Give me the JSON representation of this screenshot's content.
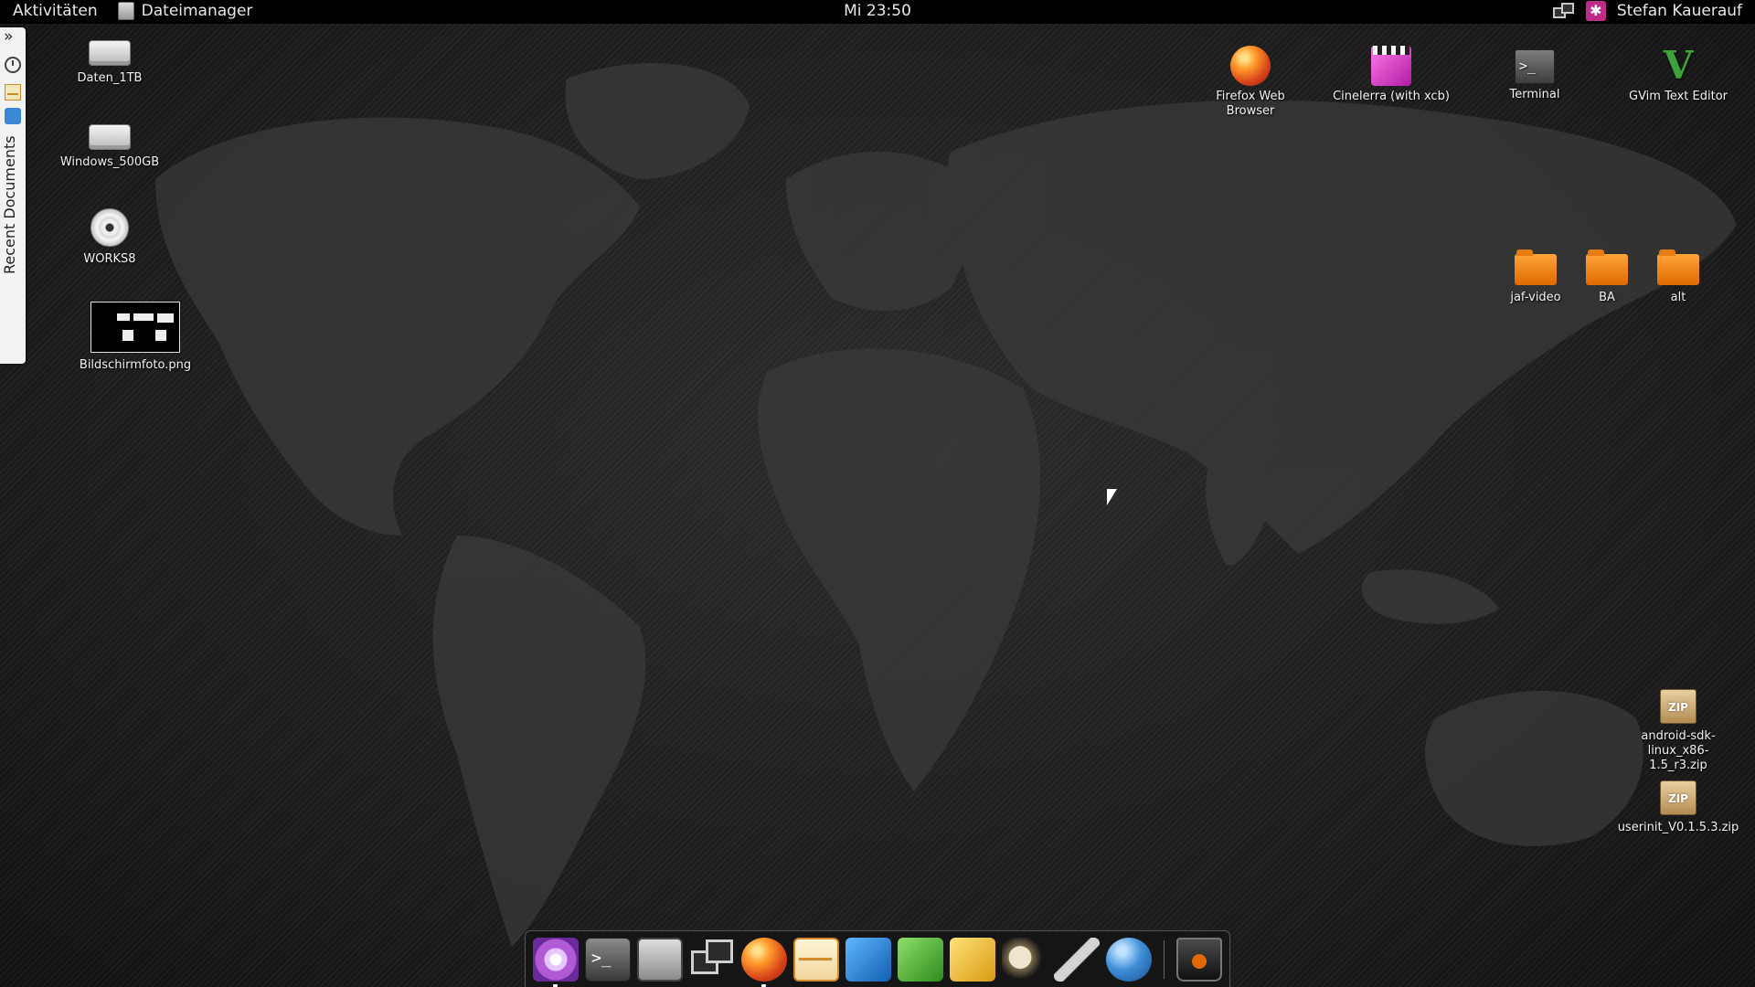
{
  "topbar": {
    "activities": "Aktivitäten",
    "app_menu": "Dateimanager",
    "clock": "Mi 23:50",
    "user": "Stefan Kauerauf"
  },
  "sidepanel": {
    "chevron": "»",
    "title": "Recent Documents"
  },
  "desktop_left": [
    {
      "label": "Daten_1TB",
      "icon": "hard-drive-icon"
    },
    {
      "label": "Windows_500GB",
      "icon": "hard-drive-icon"
    },
    {
      "label": "WORKS8",
      "icon": "cd-disc-icon"
    },
    {
      "label": "Bildschirmfoto.png",
      "icon": "image-thumbnail"
    }
  ],
  "launchers": [
    {
      "label": "Firefox Web Browser",
      "icon": "firefox-icon"
    },
    {
      "label": "Cinelerra (with xcb)",
      "icon": "cinelerra-icon"
    },
    {
      "label": "Terminal",
      "icon": "terminal-icon"
    },
    {
      "label": "GVim Text Editor",
      "icon": "gvim-icon"
    }
  ],
  "folders": [
    {
      "label": "jaf-video"
    },
    {
      "label": "BA"
    },
    {
      "label": "alt"
    }
  ],
  "zips": [
    {
      "label": "android-sdk-linux_x86-1.5_r3.zip"
    },
    {
      "label": "userinit_V0.1.5.3.zip"
    }
  ],
  "dock": {
    "items": [
      "settings-icon",
      "terminal-icon",
      "system-monitor-icon",
      "network-icon",
      "firefox-icon",
      "mail-icon",
      "blue-app-icon",
      "green-app-icon",
      "yellow-app-icon",
      "gimp-icon",
      "pen-tool-icon",
      "globe-icon",
      "trash-icon"
    ]
  },
  "colors": {
    "topbar_bg": "#000000",
    "desktop_bg": "#1f1f1f",
    "folder": "#f08a14",
    "accent_user": "#c02a8a"
  }
}
